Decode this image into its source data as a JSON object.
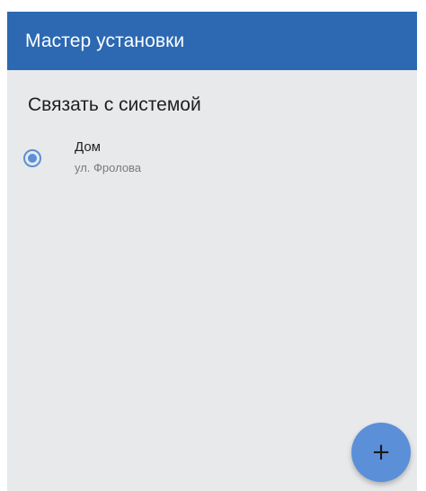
{
  "appbar": {
    "title": "Мастер установки"
  },
  "main": {
    "section_title": "Связать с системой",
    "items": [
      {
        "title": "Дом",
        "subtitle": "ул. Фролова",
        "selected": true
      }
    ]
  },
  "fab": {
    "icon": "add-icon",
    "glyph": "+"
  },
  "colors": {
    "appbar": "#2c69b2",
    "accent": "#5b8fd8",
    "background": "#e8e9eb"
  }
}
